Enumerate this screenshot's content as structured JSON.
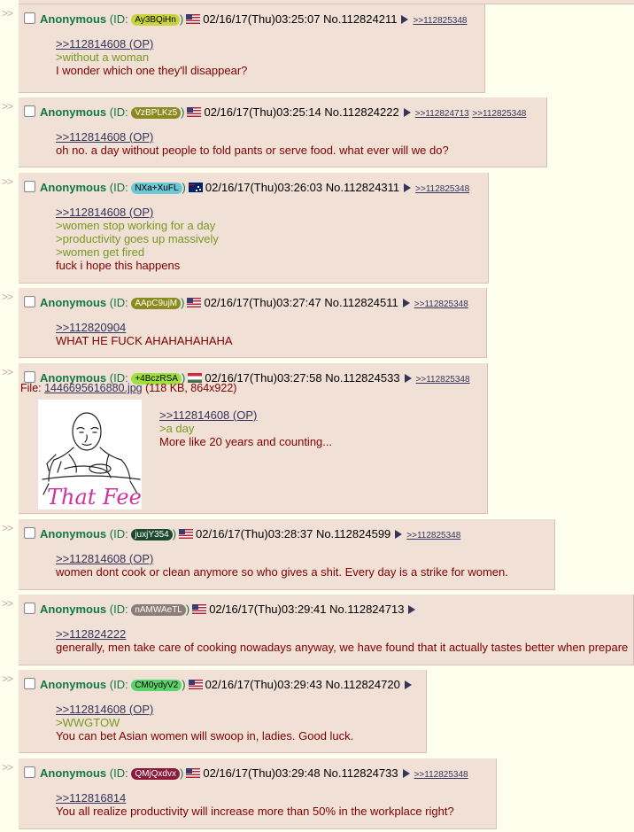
{
  "posts": [
    {
      "name": "Anonymous",
      "id_label": "(ID:",
      "id": "Ay3BQiHn",
      "id_close": ")",
      "flag": "US",
      "datetime": "02/16/17(Thu)03:25:07",
      "no_label": "No.",
      "no": "112824211",
      "backlinks": [
        ">>112825348"
      ],
      "lines": [
        {
          "t": ">>112814608 (OP)",
          "k": "quotelink"
        },
        {
          "t": ">without a woman",
          "k": "greentext"
        },
        {
          "t": "I wonder which one they'll disappear?",
          "k": "text"
        }
      ]
    },
    {
      "name": "Anonymous",
      "id_label": "(ID:",
      "id": "VzBPLKz5",
      "id_close": ")",
      "flag": "US",
      "datetime": "02/16/17(Thu)03:25:14",
      "no_label": "No.",
      "no": "112824222",
      "backlinks": [
        ">>112824713",
        ">>112825348"
      ],
      "lines": [
        {
          "t": ">>112814608 (OP)",
          "k": "quotelink"
        },
        {
          "t": "oh no. a day without people to fold pants or serve food. what ever will we do?",
          "k": "text"
        }
      ]
    },
    {
      "name": "Anonymous",
      "id_label": "(ID:",
      "id": "NXa+XuFL",
      "id_close": ")",
      "flag": "AU",
      "datetime": "02/16/17(Thu)03:26:03",
      "no_label": "No.",
      "no": "112824311",
      "backlinks": [
        ">>112825348"
      ],
      "lines": [
        {
          "t": ">>112814608 (OP)",
          "k": "quotelink"
        },
        {
          "t": ">women stop working for a day",
          "k": "greentext"
        },
        {
          "t": ">productivity goes up massively",
          "k": "greentext"
        },
        {
          "t": ">women get fired",
          "k": "greentext"
        },
        {
          "t": "fuck i hope this happens",
          "k": "text"
        }
      ]
    },
    {
      "name": "Anonymous",
      "id_label": "(ID:",
      "id": "AApC9ujM",
      "id_close": ")",
      "flag": "US",
      "datetime": "02/16/17(Thu)03:27:47",
      "no_label": "No.",
      "no": "112824511",
      "backlinks": [
        ">>112825348"
      ],
      "lines": [
        {
          "t": ">>112820904",
          "k": "quotelink"
        },
        {
          "t": "WHAT HE FUCK AHAHAHAHAHA",
          "k": "text"
        }
      ]
    },
    {
      "name": "Anonymous",
      "id_label": "(ID:",
      "id": "+4BczRSA",
      "id_close": ")",
      "flag": "HU",
      "datetime": "02/16/17(Thu)03:27:58",
      "no_label": "No.",
      "no": "112824533",
      "backlinks": [
        ">>112825348"
      ],
      "file": {
        "label": "File:",
        "filename": "1446695616880.jpg",
        "meta": "(118 KB, 864x922)",
        "thumb_caption": "That Feels"
      },
      "lines": [
        {
          "t": ">>112814608 (OP)",
          "k": "quotelink"
        },
        {
          "t": ">a day",
          "k": "greentext"
        },
        {
          "t": "More like 20 years and counting...",
          "k": "text"
        }
      ]
    },
    {
      "name": "Anonymous",
      "id_label": "(ID:",
      "id": "juxjY354",
      "id_close": ")",
      "flag": "US",
      "datetime": "02/16/17(Thu)03:28:37",
      "no_label": "No.",
      "no": "112824599",
      "backlinks": [
        ">>112825348"
      ],
      "lines": [
        {
          "t": ">>112814608 (OP)",
          "k": "quotelink"
        },
        {
          "t": "women dont cook or clean anymore so who gives a shit. Every day is a strike for women.",
          "k": "text"
        }
      ]
    },
    {
      "name": "Anonymous",
      "id_label": "(ID:",
      "id": "nAMWAeTL",
      "id_close": ")",
      "flag": "US",
      "datetime": "02/16/17(Thu)03:29:41",
      "no_label": "No.",
      "no": "112824713",
      "backlinks": [],
      "lines": [
        {
          "t": ">>112824222",
          "k": "quotelink"
        },
        {
          "t": "generally, men take care of cooking nowadays anyway, we have found that it actually tastes better when prepare",
          "k": "text"
        }
      ]
    },
    {
      "name": "Anonymous",
      "id_label": "(ID:",
      "id": "CM0ydyV2",
      "id_close": ")",
      "flag": "US",
      "datetime": "02/16/17(Thu)03:29:43",
      "no_label": "No.",
      "no": "112824720",
      "backlinks": [],
      "lines": [
        {
          "t": ">>112814608 (OP)",
          "k": "quotelink"
        },
        {
          "t": ">WWGTOW",
          "k": "greentext"
        },
        {
          "t": "You can bet Asian women will swoop in, ladies. Good luck.",
          "k": "text"
        }
      ]
    },
    {
      "name": "Anonymous",
      "id_label": "(ID:",
      "id": "QMjQxdvx",
      "id_close": ")",
      "flag": "US",
      "datetime": "02/16/17(Thu)03:29:48",
      "no_label": "No.",
      "no": "112824733",
      "backlinks": [
        ">>112825348"
      ],
      "lines": [
        {
          "t": ">>112816814",
          "k": "quotelink"
        },
        {
          "t": "You all realize productivity will increase more than 50% in the workplace right?",
          "k": "text"
        }
      ]
    }
  ],
  "side_marker": ">>",
  "colors": {
    "reply_bg": "#f0e0d6",
    "name": "#117743",
    "quotelink": "#34345c",
    "greentext": "#789922",
    "text": "#800000",
    "id_bg": [
      "#c8d43a",
      "#8b8a1e",
      "#6cc7d6",
      "#8b8a1e",
      "#9ee040",
      "#1d4a2e",
      "#8c7d78",
      "#5ad36a",
      "#8b1a3c"
    ],
    "id_fg": [
      "#000",
      "#fff",
      "#000",
      "#fff",
      "#000",
      "#fff",
      "#fff",
      "#000",
      "#fff"
    ]
  }
}
